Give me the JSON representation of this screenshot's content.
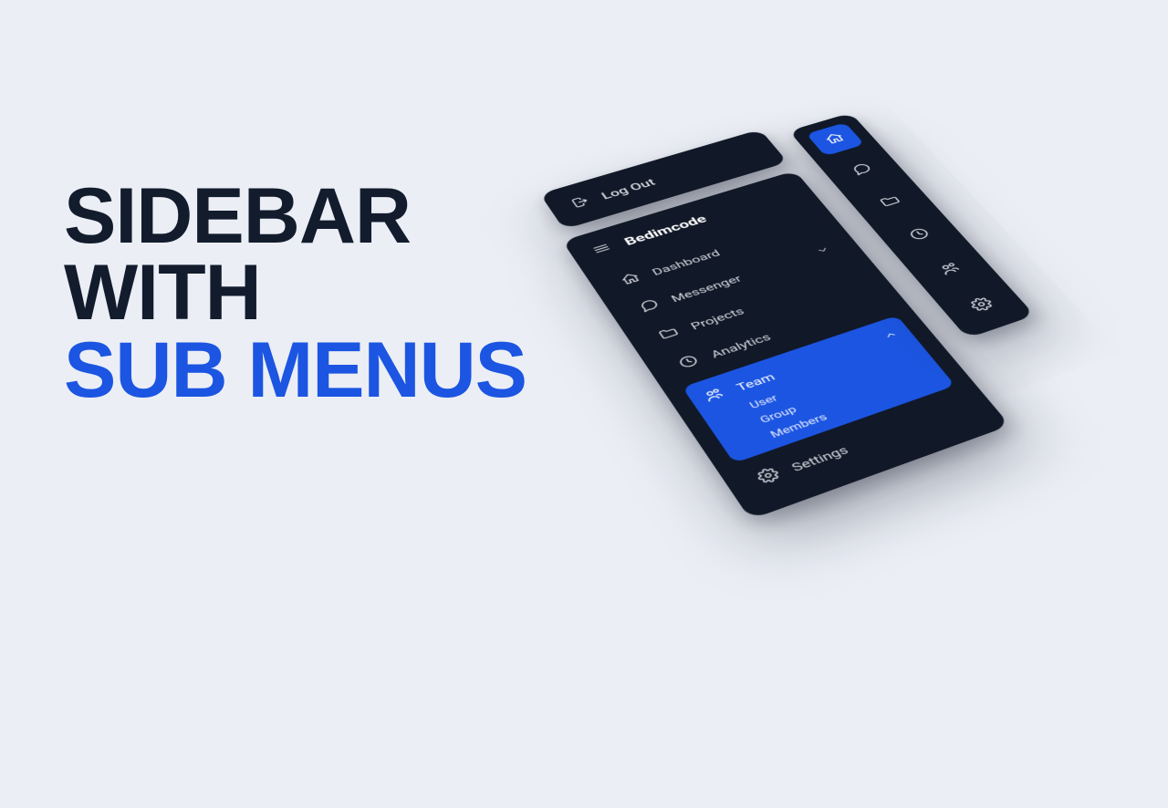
{
  "headline": {
    "line1": "SIDEBAR",
    "line2": "WITH",
    "line3": "SUB MENUS"
  },
  "logout": {
    "label": "Log Out"
  },
  "sidebar": {
    "brand": "Bedimcode",
    "items": {
      "dashboard": {
        "label": "Dashboard"
      },
      "messenger": {
        "label": "Messenger"
      },
      "projects": {
        "label": "Projects"
      },
      "analytics": {
        "label": "Analytics"
      },
      "team": {
        "label": "Team",
        "sub": {
          "user": "User",
          "group": "Group",
          "members": "Members"
        }
      },
      "settings": {
        "label": "Settings"
      }
    }
  },
  "colors": {
    "accent": "#1b55e2",
    "panel": "#111827",
    "page": "#ebeef5"
  }
}
